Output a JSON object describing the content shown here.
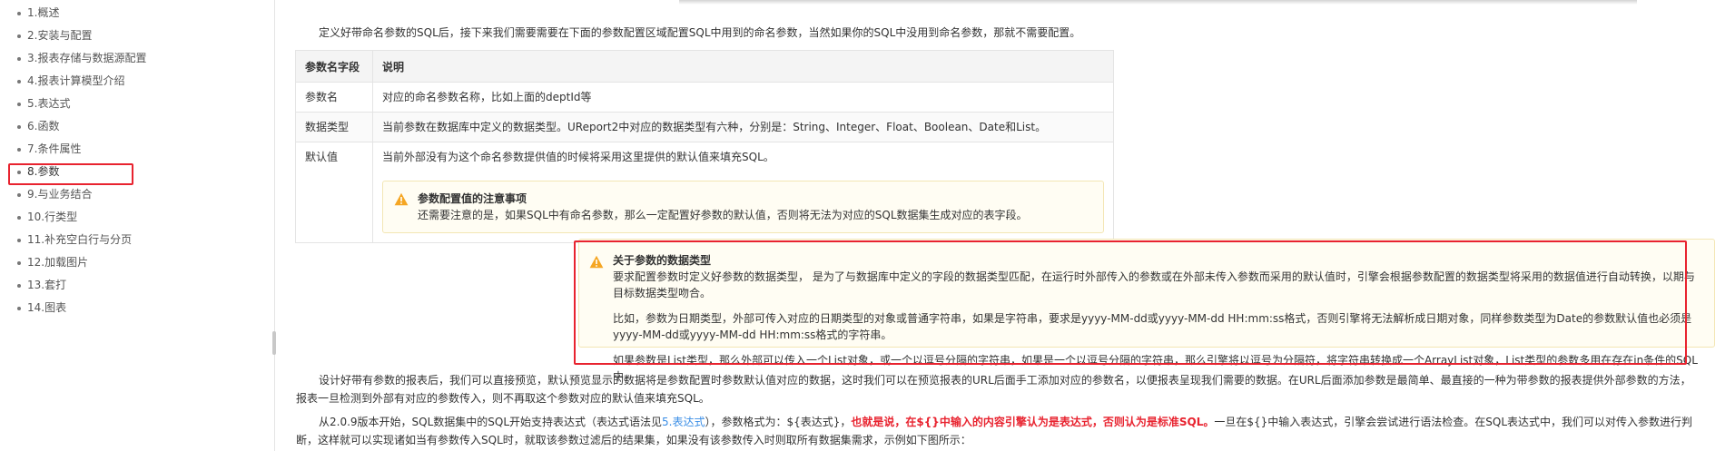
{
  "sidebar": {
    "items": [
      {
        "label": "1.概述"
      },
      {
        "label": "2.安装与配置"
      },
      {
        "label": "3.报表存储与数据源配置"
      },
      {
        "label": "4.报表计算模型介绍"
      },
      {
        "label": "5.表达式"
      },
      {
        "label": "6.函数"
      },
      {
        "label": "7.条件属性"
      },
      {
        "label": "8.参数"
      },
      {
        "label": "9.与业务结合"
      },
      {
        "label": "10.行类型"
      },
      {
        "label": "11.补充空白行与分页"
      },
      {
        "label": "12.加载图片"
      },
      {
        "label": "13.套打"
      },
      {
        "label": "14.图表"
      }
    ],
    "active_item": "8.参数"
  },
  "intro": "定义好带命名参数的SQL后，接下来我们需要需要在下面的参数配置区域配置SQL中用到的命名参数，当然如果你的SQL中没用到命名参数，那就不需要配置。",
  "param_table": {
    "headers": [
      "参数名字段",
      "说明"
    ],
    "rows": [
      {
        "field": "参数名",
        "desc": "对应的命名参数名称，比如上面的deptId等"
      },
      {
        "field": "数据类型",
        "desc": "当前参数在数据库中定义的数据类型。UReport2中对应的数据类型有六种，分别是：String、Integer、Float、Boolean、Date和List。"
      },
      {
        "field": "默认值",
        "desc": "当前外部没有为这个命名参数提供值的时候将采用这里提供的默认值来填充SQL。"
      }
    ],
    "tip": {
      "title": "参数配置值的注意事项",
      "text": "还需要注意的是，如果SQL中有命名参数，那么一定配置好参数的默认值，否则将无法为对应的SQL数据集生成对应的表字段。"
    }
  },
  "callout": {
    "title": "关于参数的数据类型",
    "line1": "要求配置参数时定义好参数的数据类型，  是为了与数据库中定义的字段的数据类型匹配，在运行时外部传入的参数或在外部未传入参数而采用的默认值时，引擎会根据参数配置的数据类型将采用的数据值进行自动转换，以期与目标数据类型吻合。",
    "para2": "比如，参数为日期类型，外部可传入对应的日期类型的对象或普通字符串，如果是字符串，要求是yyyy-MM-dd或yyyy-MM-dd HH:mm:ss格式，否则引擎将无法解析成日期对象，同样参数类型为Date的参数默认值也必须是yyyy-MM-dd或yyyy-MM-dd HH:mm:ss格式的字符串。",
    "para3": "如果参数是List类型，那么外部可以传入一个List对象，或一个以逗号分隔的字符串，如果是一个以逗号分隔的字符串，那么引擎将以逗号为分隔符，将字符串转换成一个ArrayList对象，List类型的参数多用在存在in条件的SQL中。"
  },
  "para_preview": "设计好带有参数的报表后，我们可以直接预览，默认预览显示的数据将是参数配置时参数默认值对应的数据，这时我们可以在预览报表的URL后面手工添加对应的参数名，以便报表呈现我们需要的数据。在URL后面添加参数是最简单、最直接的一种为带参数的报表提供外部参数的方法，报表一旦检测到外部有对应的参数传入，则不再取这个参数对应的默认值来填充SQL。",
  "para_expr": {
    "part1": "从2.0.9版本开始，SQL数据集中的SQL开始支持表达式（表达式语法见",
    "link": "5.表达式",
    "part2": "），参数格式为：${表达式}，",
    "emphasis": "也就是说，在${}中输入的内容引擎认为是表达式，否则认为是标准SQL。",
    "part3": "一旦在${}中输入表达式，引擎会尝试进行语法检查。在SQL表达式中，我们可以对传入参数进行判断，这样就可以实现诸如当有参数传入SQL时，就取该参数过滤后的结果集，如果没有该参数传入时则取所有数据集需求，示例如下图所示："
  },
  "colors": {
    "highlight_border": "#e8232f",
    "tip_background": "#fffdf3",
    "tip_border": "#f3e6b4",
    "link": "#3a8ee6",
    "warning_icon": "#f5a623"
  }
}
